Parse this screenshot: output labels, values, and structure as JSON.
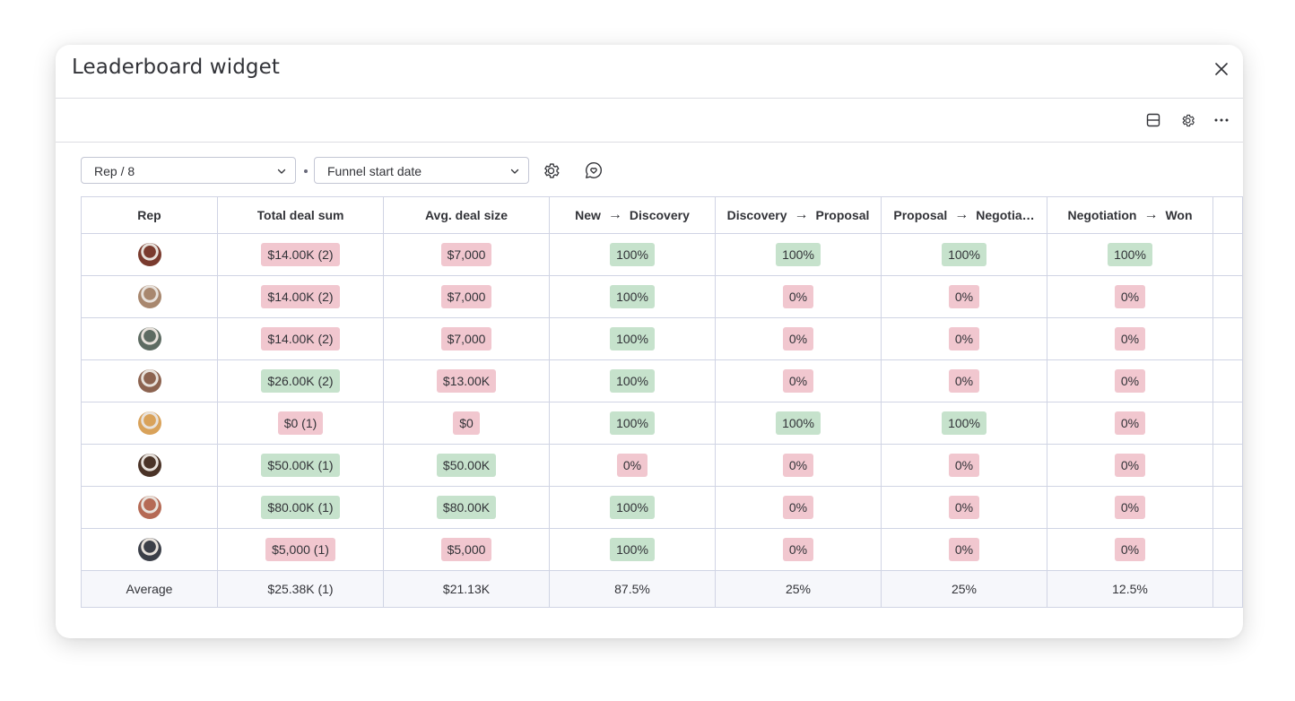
{
  "modal": {
    "title": "Leaderboard widget"
  },
  "toolbar": {
    "icons": [
      "layout-icon",
      "gear-icon",
      "more-icon"
    ]
  },
  "controls": {
    "group_by": "Rep / 8",
    "date_column": "Funnel start date"
  },
  "table": {
    "headers": [
      {
        "from": "Rep"
      },
      {
        "from": "Total deal sum"
      },
      {
        "from": "Avg. deal size"
      },
      {
        "from": "New",
        "to": "Discovery"
      },
      {
        "from": "Discovery",
        "to": "Proposal"
      },
      {
        "from": "Proposal",
        "to": "Negotia…"
      },
      {
        "from": "Negotiation",
        "to": "Won"
      }
    ],
    "rows": [
      {
        "avatar": "#7a3b2e",
        "cells": [
          [
            "$14.00K (2)",
            "bad"
          ],
          [
            "$7,000",
            "bad"
          ],
          [
            "100%",
            "good"
          ],
          [
            "100%",
            "good"
          ],
          [
            "100%",
            "good"
          ],
          [
            "100%",
            "good"
          ]
        ]
      },
      {
        "avatar": "#a8876e",
        "cells": [
          [
            "$14.00K (2)",
            "bad"
          ],
          [
            "$7,000",
            "bad"
          ],
          [
            "100%",
            "good"
          ],
          [
            "0%",
            "bad"
          ],
          [
            "0%",
            "bad"
          ],
          [
            "0%",
            "bad"
          ]
        ]
      },
      {
        "avatar": "#5d6b62",
        "cells": [
          [
            "$14.00K (2)",
            "bad"
          ],
          [
            "$7,000",
            "bad"
          ],
          [
            "100%",
            "good"
          ],
          [
            "0%",
            "bad"
          ],
          [
            "0%",
            "bad"
          ],
          [
            "0%",
            "bad"
          ]
        ]
      },
      {
        "avatar": "#8c6350",
        "cells": [
          [
            "$26.00K (2)",
            "good"
          ],
          [
            "$13.00K",
            "bad"
          ],
          [
            "100%",
            "good"
          ],
          [
            "0%",
            "bad"
          ],
          [
            "0%",
            "bad"
          ],
          [
            "0%",
            "bad"
          ]
        ]
      },
      {
        "avatar": "#d9a25a",
        "cells": [
          [
            "$0 (1)",
            "bad"
          ],
          [
            "$0",
            "bad"
          ],
          [
            "100%",
            "good"
          ],
          [
            "100%",
            "good"
          ],
          [
            "100%",
            "good"
          ],
          [
            "0%",
            "bad"
          ]
        ]
      },
      {
        "avatar": "#4a3327",
        "cells": [
          [
            "$50.00K (1)",
            "good"
          ],
          [
            "$50.00K",
            "good"
          ],
          [
            "0%",
            "bad"
          ],
          [
            "0%",
            "bad"
          ],
          [
            "0%",
            "bad"
          ],
          [
            "0%",
            "bad"
          ]
        ]
      },
      {
        "avatar": "#b56a55",
        "cells": [
          [
            "$80.00K (1)",
            "good"
          ],
          [
            "$80.00K",
            "good"
          ],
          [
            "100%",
            "good"
          ],
          [
            "0%",
            "bad"
          ],
          [
            "0%",
            "bad"
          ],
          [
            "0%",
            "bad"
          ]
        ]
      },
      {
        "avatar": "#3b3f48",
        "cells": [
          [
            "$5,000 (1)",
            "bad"
          ],
          [
            "$5,000",
            "bad"
          ],
          [
            "100%",
            "good"
          ],
          [
            "0%",
            "bad"
          ],
          [
            "0%",
            "bad"
          ],
          [
            "0%",
            "bad"
          ]
        ]
      }
    ],
    "average": {
      "label": "Average",
      "values": [
        "$25.38K (1)",
        "$21.13K",
        "87.5%",
        "25%",
        "25%",
        "12.5%"
      ]
    }
  },
  "colors": {
    "good": "#c6e2cc",
    "bad": "#f1c7cf",
    "border": "#d0d4e4"
  }
}
